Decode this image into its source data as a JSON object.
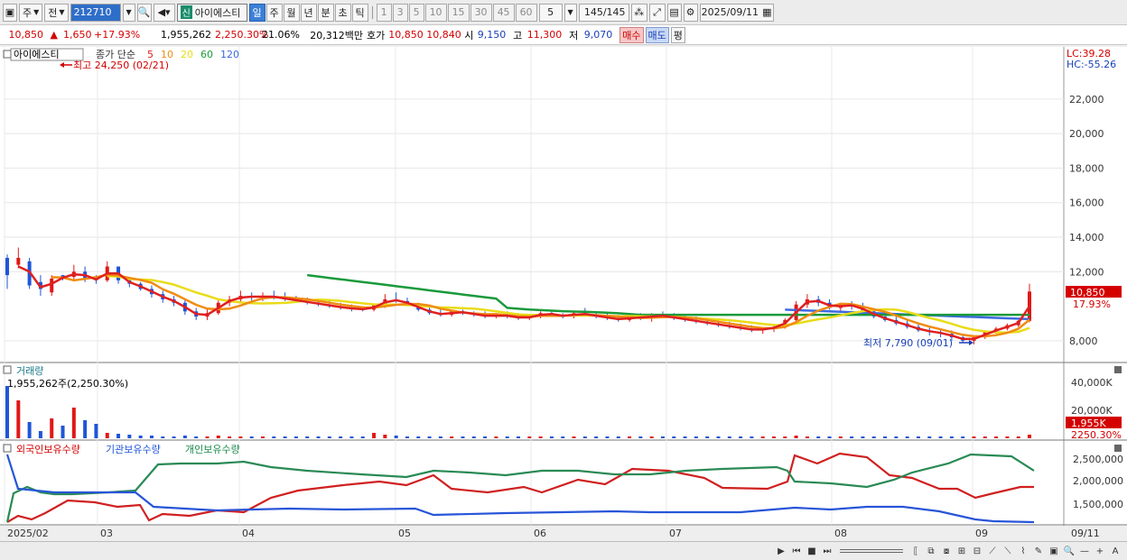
{
  "toolbar": {
    "period_week": "주",
    "period_prev": "전",
    "stock_code": "212710",
    "stock_flag": "신",
    "stock_name": "아이에스티",
    "periods": [
      "일",
      "주",
      "월",
      "년",
      "분",
      "초",
      "틱"
    ],
    "selected_period": "일",
    "intervals": [
      "1",
      "3",
      "5",
      "10",
      "15",
      "30",
      "45",
      "60"
    ],
    "interval_value": "5",
    "count_display": "145/145",
    "date": "2025/09/11"
  },
  "info": {
    "price": "10,850",
    "arrow": "▲",
    "change": "1,650",
    "change_pct": "+17.93%",
    "volume": "1,955,262",
    "volume_pct": "2,250.30%",
    "turnover_pct": "21.06%",
    "amount": "20,312백만",
    "bid_label": "호가",
    "bid1": "10,850",
    "bid2": "10,840",
    "open_label": "시",
    "open": "9,150",
    "high_label": "고",
    "high": "11,300",
    "low_label": "저",
    "low": "9,070",
    "buy_button": "매수",
    "sell_button": "매도",
    "eval_button": "평"
  },
  "chart": {
    "legend_name": "아이에스티",
    "legend_ma": "종가 단순",
    "ma_periods": [
      "5",
      "10",
      "20",
      "60",
      "120"
    ],
    "ma_colors": {
      "5": "#e02020",
      "10": "#f08c10",
      "20": "#e8dc18",
      "60": "#1a9a3a",
      "120": "#3c6ae0"
    },
    "high_annotation": "최고 24,250 (02/21)",
    "low_annotation": "최저 7,790 (09/01)",
    "lc": "LC:39.28",
    "hc": "HC:-55.26",
    "price_tag": "10,850",
    "pct_tag": "17.93%",
    "y_ticks": [
      "22,000",
      "20,000",
      "18,000",
      "16,000",
      "14,000",
      "12,000",
      "8,000"
    ],
    "volume_title": "거래량",
    "volume_value": "1,955,262주(2,250.30%)",
    "volume_ticks": [
      "40,000K",
      "20,000K"
    ],
    "volume_tag": "1,955K",
    "volume_pct_tag": "2250.30%",
    "holding_titles": [
      "외국인보유수량",
      "기관보유수량",
      "개인보유수량"
    ],
    "holding_ticks": [
      "2,500,000",
      "2,000,000",
      "1,500,000"
    ],
    "x_labels": [
      "2025/02",
      "03",
      "04",
      "05",
      "06",
      "07",
      "08",
      "09",
      "09/11"
    ]
  },
  "chart_data": {
    "type": "candlestick",
    "y_range": [
      7000,
      24500
    ],
    "candles": [
      [
        12800,
        13000,
        11000,
        11800
      ],
      [
        12400,
        13400,
        12200,
        12800
      ],
      [
        12600,
        12800,
        11000,
        11200
      ],
      [
        11400,
        11800,
        10600,
        11000
      ],
      [
        10800,
        11800,
        10600,
        11600
      ],
      [
        11800,
        11800,
        11500,
        11700
      ],
      [
        11700,
        12400,
        11500,
        12000
      ],
      [
        12000,
        12300,
        11400,
        11600
      ],
      [
        11600,
        11800,
        11300,
        11500
      ],
      [
        11500,
        12600,
        11400,
        12300
      ],
      [
        12300,
        12300,
        11300,
        11500
      ],
      [
        11500,
        11700,
        11100,
        11300
      ],
      [
        11300,
        11400,
        10900,
        11000
      ],
      [
        11000,
        11200,
        10500,
        10700
      ],
      [
        10700,
        10900,
        10200,
        10400
      ],
      [
        10400,
        10600,
        10000,
        10200
      ],
      [
        10200,
        10400,
        9500,
        9700
      ],
      [
        9700,
        9900,
        9200,
        9400
      ],
      [
        9400,
        9800,
        9200,
        9600
      ],
      [
        9600,
        10400,
        9500,
        10200
      ],
      [
        10200,
        10600,
        10000,
        10400
      ],
      [
        10400,
        10900,
        10200,
        10600
      ],
      [
        10600,
        10800,
        10300,
        10500
      ],
      [
        10500,
        10800,
        10300,
        10600
      ],
      [
        10600,
        10900,
        10400,
        10500
      ],
      [
        10500,
        10800,
        10300,
        10400
      ],
      [
        10400,
        10600,
        10200,
        10300
      ],
      [
        10300,
        10500,
        10100,
        10200
      ],
      [
        10200,
        10400,
        10000,
        10100
      ],
      [
        10100,
        10300,
        9900,
        10000
      ],
      [
        10000,
        10200,
        9800,
        9900
      ],
      [
        9900,
        10100,
        9700,
        9850
      ],
      [
        9850,
        10000,
        9700,
        9800
      ],
      [
        9800,
        10100,
        9700,
        10050
      ],
      [
        10050,
        10700,
        9900,
        10400
      ],
      [
        10400,
        10800,
        10200,
        10300
      ],
      [
        10300,
        10500,
        10000,
        10100
      ],
      [
        10100,
        10200,
        9700,
        9800
      ],
      [
        9800,
        10000,
        9500,
        9600
      ],
      [
        9600,
        9800,
        9400,
        9500
      ],
      [
        9500,
        9800,
        9400,
        9700
      ],
      [
        9700,
        9800,
        9500,
        9600
      ],
      [
        9600,
        9700,
        9400,
        9500
      ],
      [
        9500,
        9700,
        9300,
        9400
      ],
      [
        9400,
        9600,
        9300,
        9500
      ],
      [
        9500,
        9700,
        9300,
        9400
      ],
      [
        9400,
        9600,
        9200,
        9300
      ],
      [
        9300,
        9500,
        9200,
        9400
      ],
      [
        9400,
        9700,
        9300,
        9600
      ],
      [
        9600,
        9700,
        9400,
        9500
      ],
      [
        9500,
        9600,
        9300,
        9400
      ],
      [
        9400,
        9700,
        9300,
        9600
      ],
      [
        9600,
        9900,
        9400,
        9500
      ],
      [
        9500,
        9700,
        9300,
        9400
      ],
      [
        9400,
        9600,
        9200,
        9300
      ],
      [
        9300,
        9500,
        9100,
        9200
      ],
      [
        9200,
        9500,
        9100,
        9400
      ],
      [
        9400,
        9600,
        9200,
        9300
      ],
      [
        9300,
        9600,
        9100,
        9500
      ],
      [
        9500,
        9700,
        9300,
        9400
      ],
      [
        9400,
        9600,
        9200,
        9300
      ],
      [
        9300,
        9500,
        9100,
        9200
      ],
      [
        9200,
        9400,
        9000,
        9100
      ],
      [
        9100,
        9300,
        8900,
        9000
      ],
      [
        9000,
        9200,
        8800,
        8900
      ],
      [
        8900,
        9100,
        8700,
        8800
      ],
      [
        8800,
        9000,
        8600,
        8700
      ],
      [
        8700,
        8900,
        8500,
        8600
      ],
      [
        8600,
        8800,
        8400,
        8700
      ],
      [
        8700,
        8900,
        8500,
        8800
      ],
      [
        8800,
        9300,
        8700,
        9200
      ],
      [
        9200,
        10300,
        9100,
        10100
      ],
      [
        10100,
        10700,
        9900,
        10400
      ],
      [
        10400,
        10600,
        10000,
        10200
      ],
      [
        10200,
        10400,
        9800,
        9900
      ],
      [
        9900,
        10200,
        9700,
        10100
      ],
      [
        10100,
        10300,
        9800,
        10000
      ],
      [
        10000,
        10200,
        9600,
        9700
      ],
      [
        9700,
        9900,
        9300,
        9400
      ],
      [
        9400,
        9600,
        9100,
        9200
      ],
      [
        9200,
        9400,
        8900,
        9000
      ],
      [
        9000,
        9200,
        8700,
        8800
      ],
      [
        8800,
        9000,
        8500,
        8600
      ],
      [
        8600,
        8800,
        8300,
        8500
      ],
      [
        8500,
        8700,
        8200,
        8400
      ],
      [
        8400,
        8600,
        8000,
        8200
      ],
      [
        8200,
        8400,
        7900,
        8000
      ],
      [
        8000,
        8300,
        7790,
        8200
      ],
      [
        8200,
        8600,
        8100,
        8500
      ],
      [
        8500,
        8800,
        8400,
        8700
      ],
      [
        8700,
        9000,
        8600,
        8900
      ],
      [
        8900,
        9200,
        8800,
        9150
      ],
      [
        9150,
        11300,
        9070,
        10850
      ]
    ],
    "ma5_last": 10850,
    "volume_last": 1955262,
    "holding_series": {
      "foreign_range": [
        1400000,
        2700000
      ],
      "institution_range": [
        1000000,
        2600000
      ],
      "individual_range": [
        1100000,
        2600000
      ]
    }
  }
}
